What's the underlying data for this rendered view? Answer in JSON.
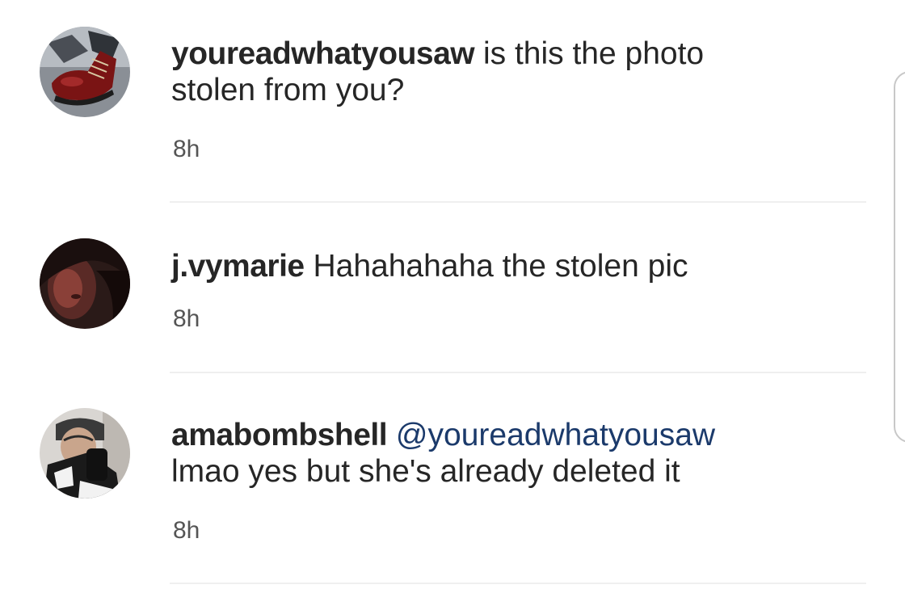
{
  "comments": [
    {
      "username": "youreadwhatyousaw",
      "text_line1": " is this the photo",
      "text_line2": "stolen from you?",
      "time": "8h",
      "avatar_icon": "boot-photo-avatar"
    },
    {
      "username": "j.vymarie",
      "text_line1": " Hahahahaha the stolen pic",
      "time": "8h",
      "avatar_icon": "dark-portrait-avatar"
    },
    {
      "username": "amabombshell",
      "mention": "@youreadwhatyousaw",
      "text_line2": "lmao yes but she's already deleted  it",
      "time": "8h",
      "avatar_icon": "selfie-portrait-avatar"
    }
  ],
  "colors": {
    "text": "#262626",
    "mention": "#1b3a6b",
    "timestamp": "#555555",
    "divider": "#efefef"
  }
}
